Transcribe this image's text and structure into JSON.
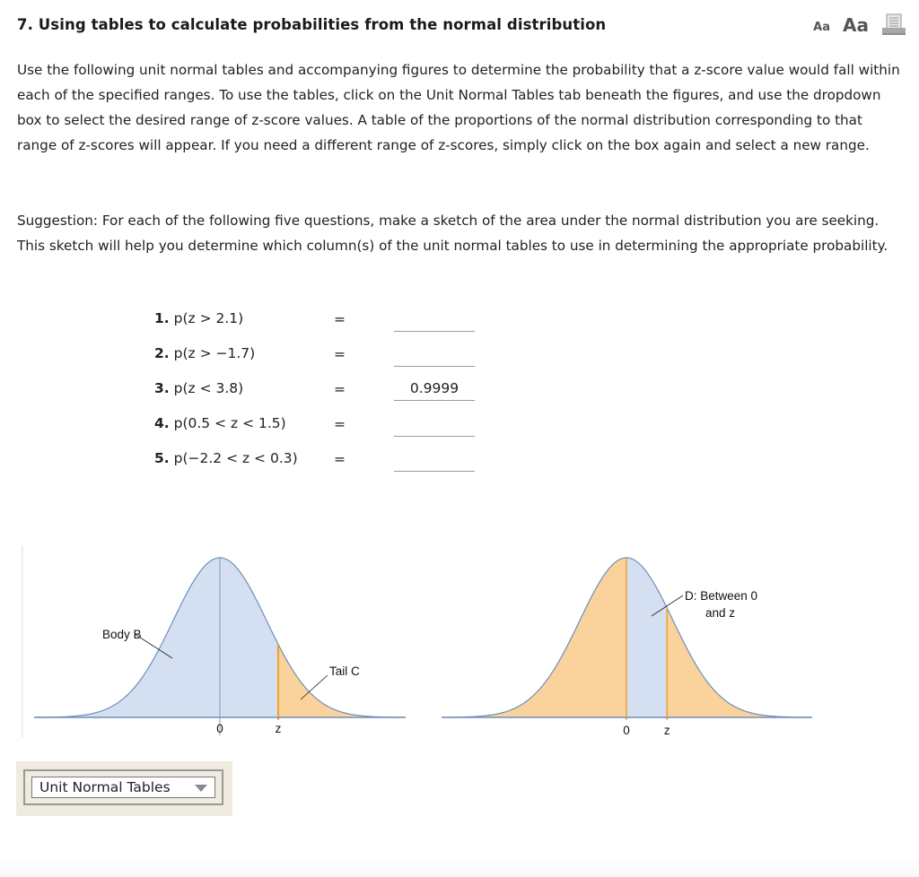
{
  "question": {
    "title": "7. Using tables to calculate probabilities from the normal distribution",
    "tools": {
      "small_font_label": "Aa",
      "large_font_label": "Aa",
      "print_icon": "print-icon"
    },
    "instructions": "Use the following unit normal tables and accompanying figures to determine the probability that a z-score value would fall within each of the specified ranges. To use the tables, click on the Unit Normal Tables tab beneath the figures, and use the dropdown box to select the desired range of z-score values. A table of the proportions of the normal distribution corresponding to that range of z-scores will appear. If you need a different range of z-scores, simply click on the box again and select a new range.",
    "suggestion": "Suggestion: For each of the following five questions, make a sketch of the area under the normal distribution you are seeking. This sketch will help you determine which column(s) of the unit normal tables to use in determining the appropriate probability.",
    "items": [
      {
        "num": "1.",
        "expr": "p(z > 2.1)",
        "eq": "=",
        "answer": ""
      },
      {
        "num": "2.",
        "expr": "p(z > −1.7)",
        "eq": "=",
        "answer": ""
      },
      {
        "num": "3.",
        "expr": "p(z < 3.8)",
        "eq": "=",
        "answer": "0.9999"
      },
      {
        "num": "4.",
        "expr": "p(0.5 < z < 1.5)",
        "eq": "=",
        "answer": ""
      },
      {
        "num": "5.",
        "expr": "p(−2.2 < z < 0.3)",
        "eq": "=",
        "answer": ""
      }
    ],
    "figures": {
      "left": {
        "body_label": "Body B",
        "tail_label": "Tail C",
        "tick_zero": "0",
        "tick_z": "z",
        "z_value": 1.25
      },
      "right": {
        "between_label_line1": "D: Between 0",
        "between_label_line2": "and z",
        "tick_zero": "0",
        "tick_z": "z",
        "z_value": 0.87
      },
      "colors": {
        "body_fill": "#d4e0f1",
        "tail_fill": "#f9d29c",
        "curve_stroke": "#6f8fb8",
        "z_line": "#f0a030",
        "center_line": "#8a9ab0"
      }
    },
    "dropdown": {
      "selected": "Unit Normal Tables"
    }
  }
}
